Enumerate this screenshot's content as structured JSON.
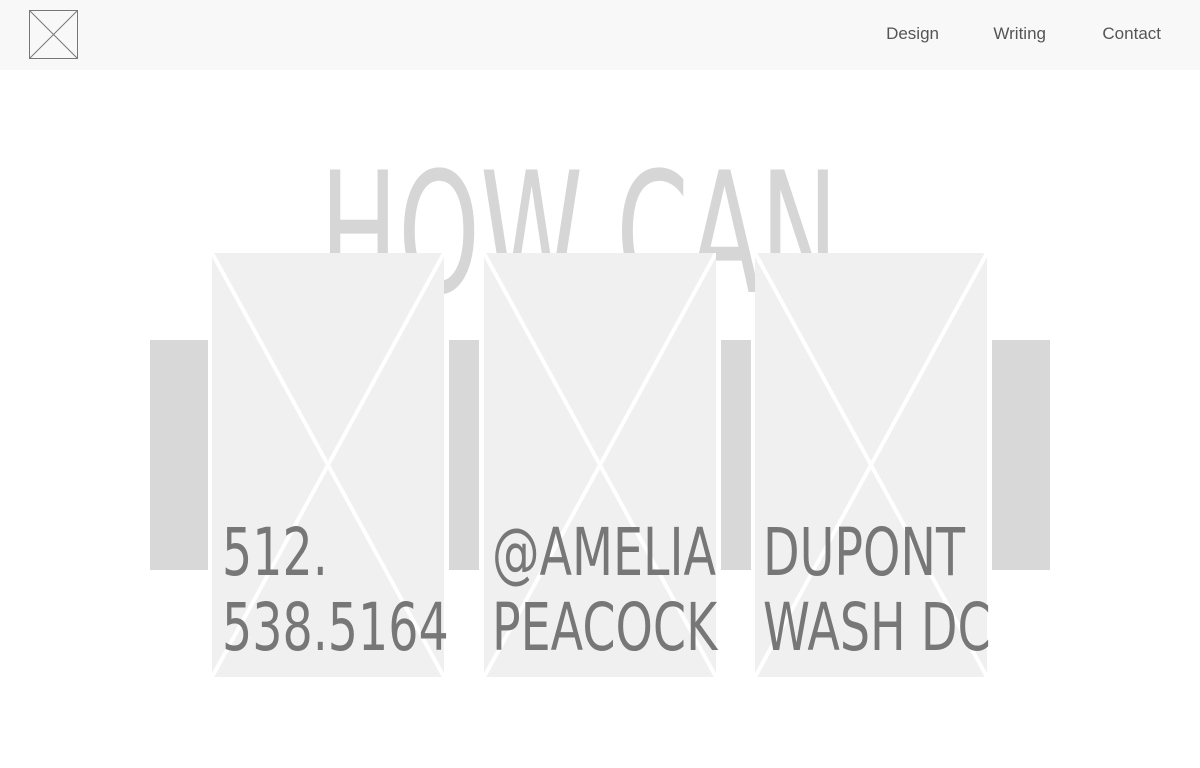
{
  "header": {
    "logo_icon": "placeholder-x-icon",
    "nav": [
      {
        "label": "Design"
      },
      {
        "label": "Writing"
      },
      {
        "label": "Contact"
      }
    ]
  },
  "main": {
    "headline": "HOW CAN I HELP?",
    "cards": [
      {
        "line1": "512.",
        "line2": "538.5164",
        "icon": "placeholder-image-icon"
      },
      {
        "line1": "@AMELIA",
        "line2": "PEACOCK",
        "icon": "placeholder-image-icon"
      },
      {
        "line1": "DUPONT",
        "line2": "WASH DC",
        "icon": "placeholder-image-icon"
      }
    ]
  },
  "colors": {
    "header_bg": "#f8f8f8",
    "headline": "#d6d6d6",
    "card_bg": "#f0f0f0",
    "strip": "#d8d8d8",
    "card_text": "#777777"
  }
}
